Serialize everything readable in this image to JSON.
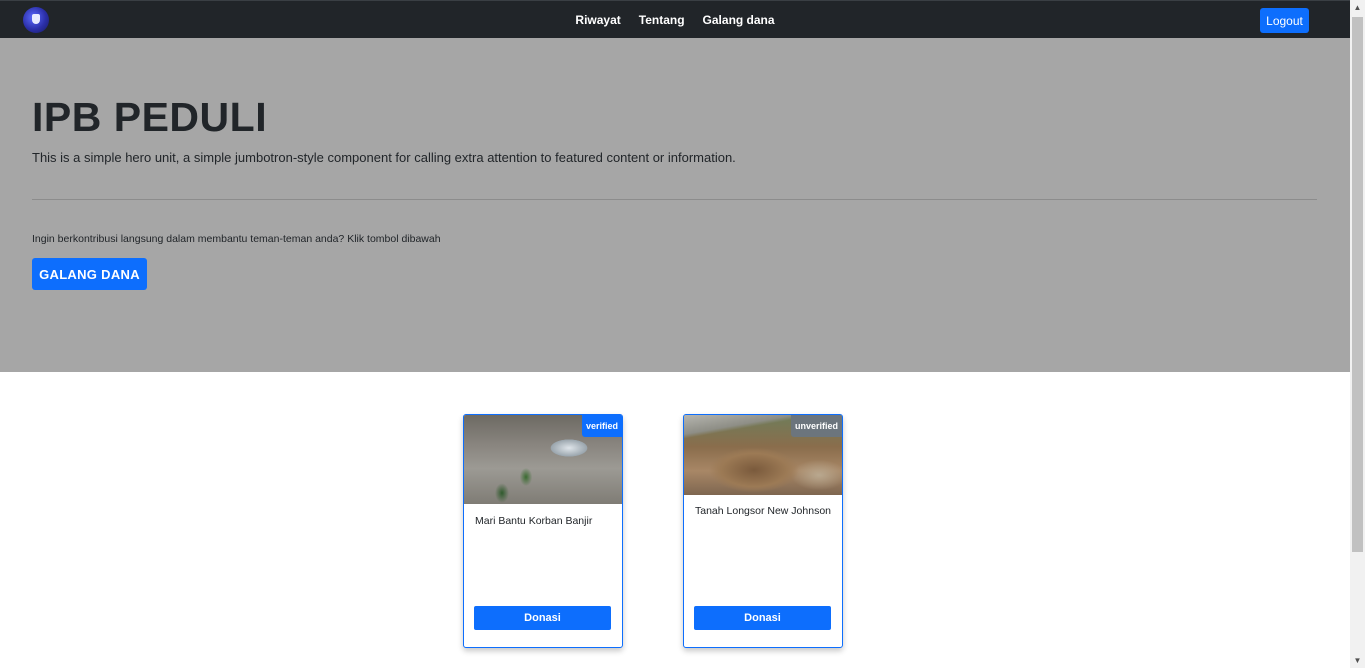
{
  "navbar": {
    "logo_name": "ipb-logo",
    "links": [
      "Riwayat",
      "Tentang",
      "Galang dana"
    ],
    "logout_label": "Logout"
  },
  "hero": {
    "title": "IPB PEDULI",
    "lead": "This is a simple hero unit, a simple jumbotron-style component for calling extra attention to featured content or information.",
    "text": "Ingin berkontribusi langsung dalam membantu teman-teman anda? Klik tombol dibawah",
    "button_label": "GALANG DANA"
  },
  "campaigns": [
    {
      "title": "Mari Bantu Korban Banjir",
      "status": "verified",
      "button_label": "Donasi"
    },
    {
      "title": "Tanah Longsor New Johnson",
      "status": "unverified",
      "button_label": "Donasi"
    }
  ],
  "colors": {
    "navbar": "#212529",
    "hero_bg": "#a6a6a6",
    "primary": "#0d6efd",
    "unverified": "#6c757d"
  }
}
